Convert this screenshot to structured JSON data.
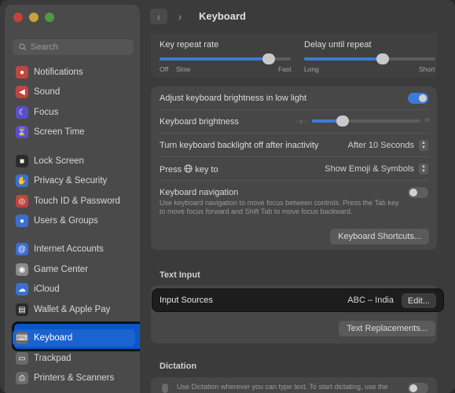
{
  "window": {
    "title": "Keyboard",
    "colors": {
      "accent": "#3b7bd8",
      "selected": "#1a63d0"
    }
  },
  "sidebar": {
    "search_placeholder": "Search",
    "items": [
      {
        "label": "Notifications",
        "icon": "bell-icon",
        "color": "#c0453f"
      },
      {
        "label": "Sound",
        "icon": "speaker-icon",
        "color": "#c0453f"
      },
      {
        "label": "Focus",
        "icon": "moon-icon",
        "color": "#5a4fc7"
      },
      {
        "label": "Screen Time",
        "icon": "hourglass-icon",
        "color": "#5a4fc7"
      },
      {
        "label": "Lock Screen",
        "icon": "lock-icon",
        "color": "#2b2b2b"
      },
      {
        "label": "Privacy & Security",
        "icon": "hand-icon",
        "color": "#3b6fd0"
      },
      {
        "label": "Touch ID & Password",
        "icon": "fingerprint-icon",
        "color": "#c0453f"
      },
      {
        "label": "Users & Groups",
        "icon": "users-icon",
        "color": "#3b6fd0"
      },
      {
        "label": "Internet Accounts",
        "icon": "at-icon",
        "color": "#3b6fd0"
      },
      {
        "label": "Game Center",
        "icon": "game-center-icon",
        "color": "#8a8a8a"
      },
      {
        "label": "iCloud",
        "icon": "cloud-icon",
        "color": "#3b6fd0"
      },
      {
        "label": "Wallet & Apple Pay",
        "icon": "wallet-icon",
        "color": "#2b2b2b"
      },
      {
        "label": "Keyboard",
        "icon": "keyboard-icon",
        "color": "#6a6a6a"
      },
      {
        "label": "Trackpad",
        "icon": "trackpad-icon",
        "color": "#6a6a6a"
      },
      {
        "label": "Printers & Scanners",
        "icon": "printer-icon",
        "color": "#6a6a6a"
      }
    ]
  },
  "toolbar": {
    "back": "‹",
    "forward": "›"
  },
  "repeat": {
    "key_repeat_label": "Key repeat rate",
    "key_repeat_min": "Off",
    "key_repeat_slow": "Slow",
    "key_repeat_max": "Fast",
    "key_repeat_value": 0.83,
    "delay_label": "Delay until repeat",
    "delay_min": "Long",
    "delay_max": "Short",
    "delay_value": 0.6
  },
  "settings": {
    "adjust_brightness_label": "Adjust keyboard brightness in low light",
    "adjust_brightness_on": true,
    "brightness_label": "Keyboard brightness",
    "brightness_value": 0.28,
    "backlight_off_label": "Turn keyboard backlight off after inactivity",
    "backlight_off_value": "After 10 Seconds",
    "press_key_label_before": "Press",
    "press_key_label_after": "key to",
    "press_key_value": "Show Emoji & Symbols",
    "nav_label": "Keyboard navigation",
    "nav_help": "Use keyboard navigation to move focus between controls. Press the Tab key to move focus forward and Shift Tab to move focus backward.",
    "nav_on": false,
    "shortcuts_button": "Keyboard Shortcuts..."
  },
  "text_input": {
    "section_title": "Text Input",
    "input_sources_label": "Input Sources",
    "input_sources_value": "ABC – India",
    "edit_button": "Edit...",
    "replacements_button": "Text Replacements..."
  },
  "dictation": {
    "section_title": "Dictation",
    "help": "Use Dictation wherever you can type text. To start dictating, use the"
  }
}
